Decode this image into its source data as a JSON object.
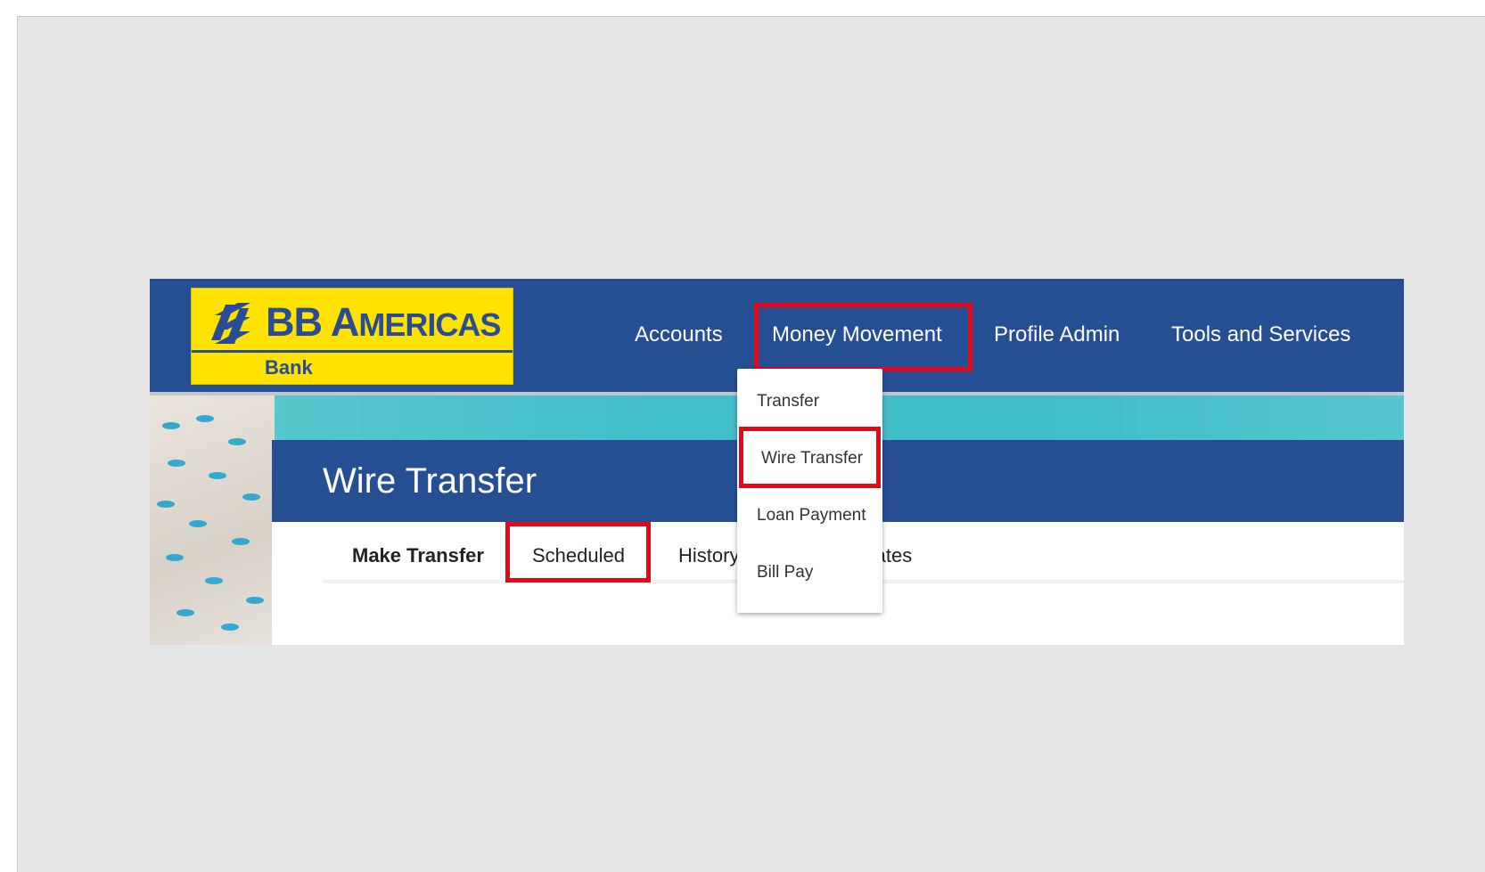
{
  "logo": {
    "main": "BB",
    "sub_word_cap": "A",
    "sub_word_rest": "MERICAS",
    "tagline": "Bank"
  },
  "nav": {
    "items": [
      {
        "label": "Accounts"
      },
      {
        "label": "Money Movement"
      },
      {
        "label": "Profile Admin"
      },
      {
        "label": "Tools and Services"
      }
    ]
  },
  "dropdown": {
    "items": [
      {
        "label": "Transfer"
      },
      {
        "label": "Wire Transfer"
      },
      {
        "label": "Loan Payment"
      },
      {
        "label": "Bill Pay"
      }
    ]
  },
  "page": {
    "title": "Wire Transfer"
  },
  "tabs": [
    {
      "label": "Make Transfer"
    },
    {
      "label": "Scheduled"
    },
    {
      "label": "History"
    },
    {
      "label": "Templates"
    }
  ],
  "colors": {
    "brand_blue": "#264f93",
    "logo_yellow": "#ffe300",
    "highlight_red": "#e3091a"
  }
}
